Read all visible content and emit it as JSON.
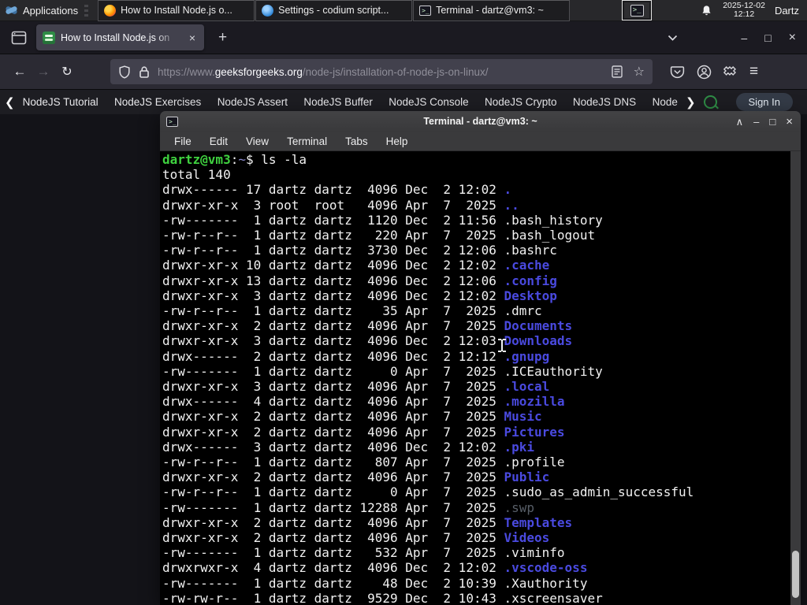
{
  "panel": {
    "applications_label": "Applications",
    "windows": [
      {
        "icon": "firefox",
        "title": "How to Install Node.js o..."
      },
      {
        "icon": "codium",
        "title": "Settings - codium script..."
      },
      {
        "icon": "terminal",
        "title": "Terminal - dartz@vm3: ~"
      }
    ],
    "tray": {
      "date": "2025-12-02",
      "time": "12:12",
      "user": "Dartz"
    }
  },
  "browser": {
    "tab": {
      "title": "How to Install Node.js on",
      "close_glyph": "×"
    },
    "newtab_glyph": "+",
    "window_controls": {
      "minimize": "–",
      "maximize": "□",
      "close": "×"
    },
    "nav": {
      "back_glyph": "←",
      "forward_glyph": "→",
      "reload_glyph": "↻"
    },
    "url": {
      "prefix": "https://www.",
      "host": "geeksforgeeks.org",
      "path": "/node-js/installation-of-node-js-on-linux/"
    },
    "menu_glyph": "≡",
    "star_glyph": "☆"
  },
  "gfg_nav": {
    "scroll_left_glyph": "❮",
    "scroll_right_glyph": "❯",
    "items": [
      "NodeJS Tutorial",
      "NodeJS Exercises",
      "NodeJS Assert",
      "NodeJS Buffer",
      "NodeJS Console",
      "NodeJS Crypto",
      "NodeJS DNS",
      "Node"
    ],
    "sign_in_label": "Sign In"
  },
  "terminal": {
    "title": "Terminal - dartz@vm3: ~",
    "controls": {
      "shade": "∧",
      "minimize": "–",
      "maximize": "□",
      "close": "×"
    },
    "menu": [
      "File",
      "Edit",
      "View",
      "Terminal",
      "Tabs",
      "Help"
    ],
    "prompt": {
      "user": "dartz@vm3",
      "separator": ":",
      "path": "~",
      "command": "$ ls -la"
    },
    "total_line": "total 140",
    "rows": [
      {
        "pre": "drwx------ 17 dartz dartz  4096 Dec  2 12:02 ",
        "name": ".",
        "type": "dir"
      },
      {
        "pre": "drwxr-xr-x  3 root  root   4096 Apr  7  2025 ",
        "name": "..",
        "type": "dir"
      },
      {
        "pre": "-rw-------  1 dartz dartz  1120 Dec  2 11:56 ",
        "name": ".bash_history",
        "type": "file"
      },
      {
        "pre": "-rw-r--r--  1 dartz dartz   220 Apr  7  2025 ",
        "name": ".bash_logout",
        "type": "file"
      },
      {
        "pre": "-rw-r--r--  1 dartz dartz  3730 Dec  2 12:06 ",
        "name": ".bashrc",
        "type": "file"
      },
      {
        "pre": "drwxr-xr-x 10 dartz dartz  4096 Dec  2 12:02 ",
        "name": ".cache",
        "type": "dir"
      },
      {
        "pre": "drwxr-xr-x 13 dartz dartz  4096 Dec  2 12:06 ",
        "name": ".config",
        "type": "dir"
      },
      {
        "pre": "drwxr-xr-x  3 dartz dartz  4096 Dec  2 12:02 ",
        "name": "Desktop",
        "type": "dir"
      },
      {
        "pre": "-rw-r--r--  1 dartz dartz    35 Apr  7  2025 ",
        "name": ".dmrc",
        "type": "file"
      },
      {
        "pre": "drwxr-xr-x  2 dartz dartz  4096 Apr  7  2025 ",
        "name": "Documents",
        "type": "dir"
      },
      {
        "pre": "drwxr-xr-x  3 dartz dartz  4096 Dec  2 12:03 ",
        "name": "Downloads",
        "type": "dir"
      },
      {
        "pre": "drwx------  2 dartz dartz  4096 Dec  2 12:12 ",
        "name": ".gnupg",
        "type": "dir"
      },
      {
        "pre": "-rw-------  1 dartz dartz     0 Apr  7  2025 ",
        "name": ".ICEauthority",
        "type": "file"
      },
      {
        "pre": "drwxr-xr-x  3 dartz dartz  4096 Apr  7  2025 ",
        "name": ".local",
        "type": "dir"
      },
      {
        "pre": "drwx------  4 dartz dartz  4096 Apr  7  2025 ",
        "name": ".mozilla",
        "type": "dir"
      },
      {
        "pre": "drwxr-xr-x  2 dartz dartz  4096 Apr  7  2025 ",
        "name": "Music",
        "type": "dir"
      },
      {
        "pre": "drwxr-xr-x  2 dartz dartz  4096 Apr  7  2025 ",
        "name": "Pictures",
        "type": "dir"
      },
      {
        "pre": "drwx------  3 dartz dartz  4096 Dec  2 12:02 ",
        "name": ".pki",
        "type": "dir"
      },
      {
        "pre": "-rw-r--r--  1 dartz dartz   807 Apr  7  2025 ",
        "name": ".profile",
        "type": "file"
      },
      {
        "pre": "drwxr-xr-x  2 dartz dartz  4096 Apr  7  2025 ",
        "name": "Public",
        "type": "dir"
      },
      {
        "pre": "-rw-r--r--  1 dartz dartz     0 Apr  7  2025 ",
        "name": ".sudo_as_admin_successful",
        "type": "file"
      },
      {
        "pre": "-rw-------  1 dartz dartz 12288 Apr  7  2025 ",
        "name": ".swp",
        "type": "dim"
      },
      {
        "pre": "drwxr-xr-x  2 dartz dartz  4096 Apr  7  2025 ",
        "name": "Templates",
        "type": "dir"
      },
      {
        "pre": "drwxr-xr-x  2 dartz dartz  4096 Apr  7  2025 ",
        "name": "Videos",
        "type": "dir"
      },
      {
        "pre": "-rw-------  1 dartz dartz   532 Apr  7  2025 ",
        "name": ".viminfo",
        "type": "file"
      },
      {
        "pre": "drwxrwxr-x  4 dartz dartz  4096 Dec  2 12:02 ",
        "name": ".vscode-oss",
        "type": "dir"
      },
      {
        "pre": "-rw-------  1 dartz dartz    48 Dec  2 10:39 ",
        "name": ".Xauthority",
        "type": "file"
      },
      {
        "pre": "-rw-rw-r--  1 dartz dartz  9529 Dec  2 10:43 ",
        "name": ".xscreensaver",
        "type": "file"
      }
    ]
  },
  "colors": {
    "prompt_green": "#3fd13f",
    "directory_blue": "#4a4ae0",
    "gfg_green": "#2f8d46",
    "terminal_bg": "#000000"
  }
}
